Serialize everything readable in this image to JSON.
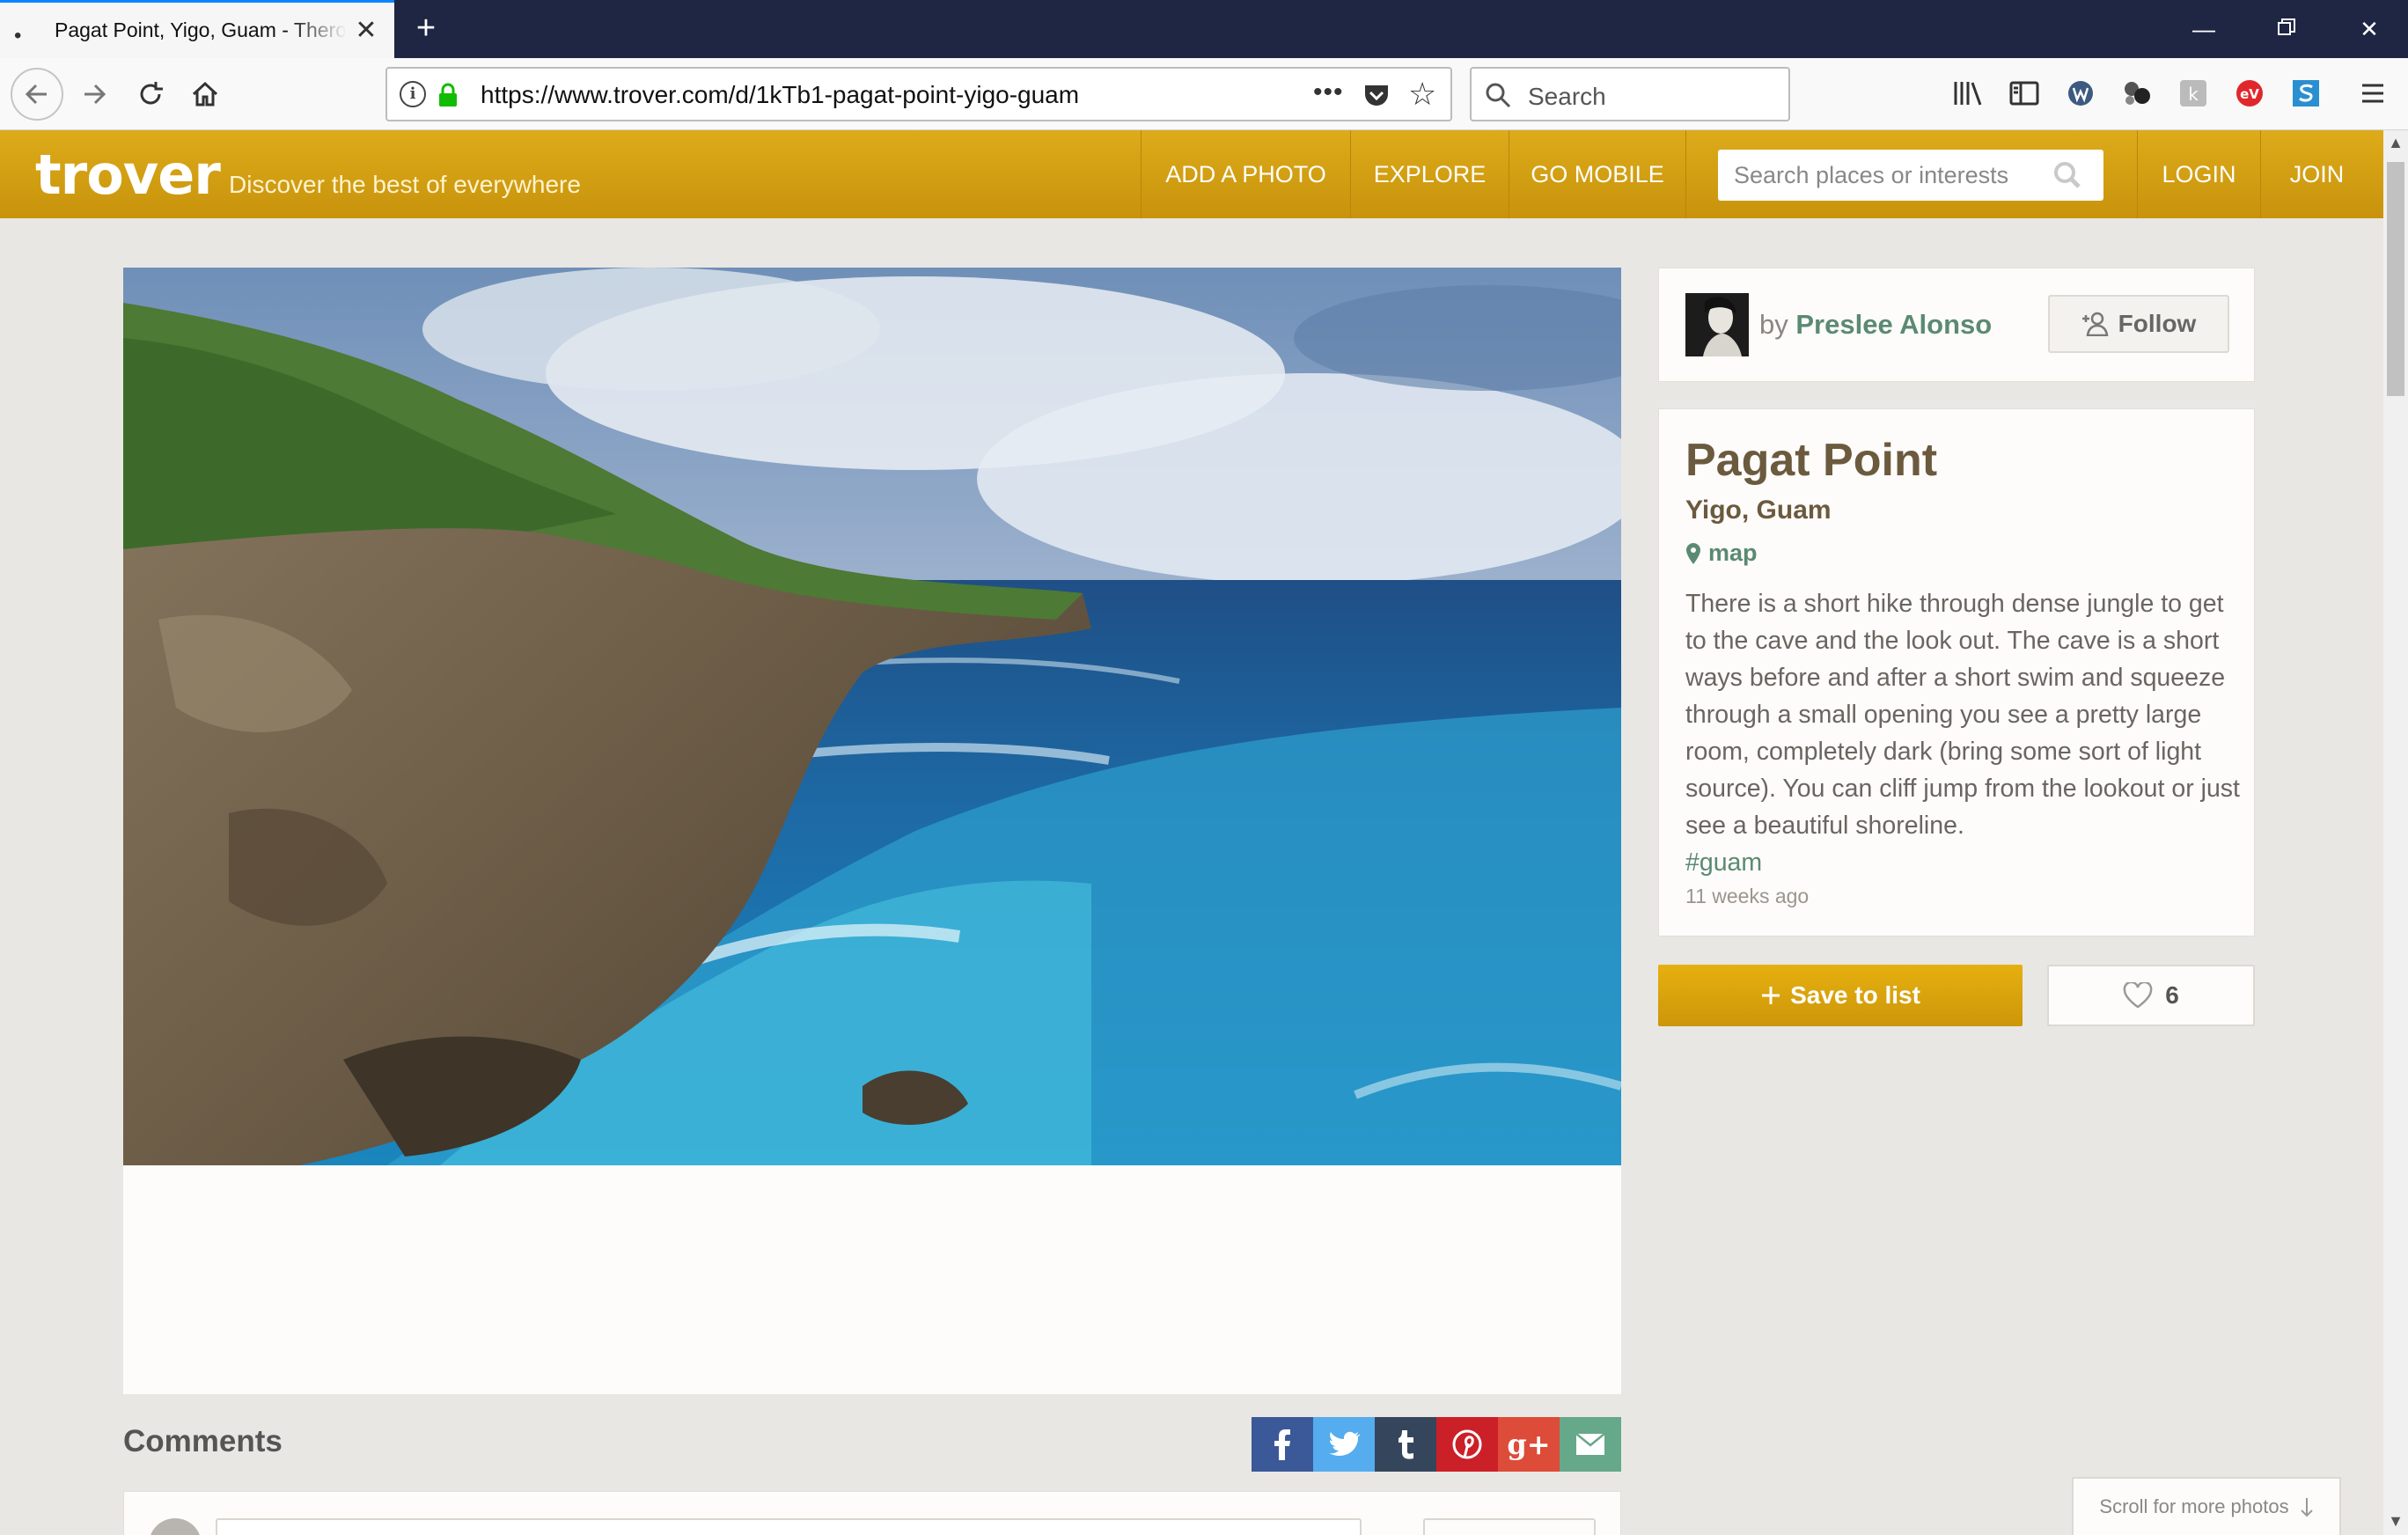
{
  "browser": {
    "tab_title": "Pagat Point, Yigo, Guam - Thero",
    "tab_dot": "•",
    "url": "https://www.trover.com/d/1kTb1-pagat-point-yigo-guam",
    "search_placeholder": "Search"
  },
  "site": {
    "logo": "trover",
    "tagline": "Discover the best of everywhere",
    "nav": [
      "ADD A PHOTO",
      "EXPLORE",
      "GO MOBILE"
    ],
    "search_placeholder": "Search places or interests",
    "login": "LOGIN",
    "join": "JOIN",
    "accent_color": "#d4a114"
  },
  "author": {
    "by": "by",
    "name": "Preslee Alonso",
    "follow_label": "Follow"
  },
  "place": {
    "title": "Pagat Point",
    "location": "Yigo, Guam",
    "map_label": "map",
    "description": "There is a short hike through dense jungle to get to the cave and the look out. The cave is a short ways before and after a short swim and squeeze through a small opening you see a pretty large room, completely dark (bring some sort of light source). You can cliff jump from the lookout or just see a beautiful shoreline.",
    "hashtag": "#guam",
    "time_ago": "11 weeks ago"
  },
  "actions": {
    "save_label": "Save to list",
    "likes": "6"
  },
  "comments": {
    "title": "Comments"
  },
  "share": [
    {
      "name": "facebook",
      "glyph": "f",
      "color": "#3b5998"
    },
    {
      "name": "twitter",
      "glyph": "t",
      "color": "#55acee"
    },
    {
      "name": "tumblr",
      "glyph": "t",
      "color": "#35465c"
    },
    {
      "name": "pinterest",
      "glyph": "p",
      "color": "#cb2027"
    },
    {
      "name": "google-plus",
      "glyph": "g+",
      "color": "#dd4b39"
    },
    {
      "name": "email",
      "glyph": "✉",
      "color": "#66a88a"
    }
  ],
  "scroll_more_label": "Scroll for more photos"
}
